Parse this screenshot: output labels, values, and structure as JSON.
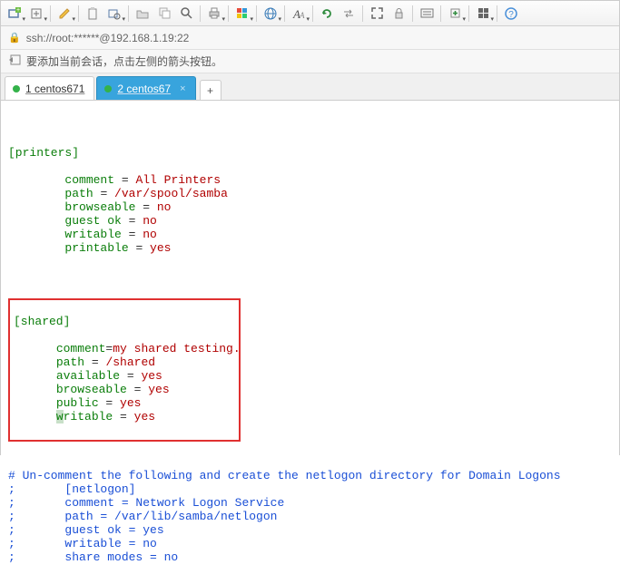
{
  "address": "ssh://root:******@192.168.1.19:22",
  "hint": "要添加当前会话，点击左侧的箭头按钮。",
  "tabs": [
    {
      "label": "1 centos671",
      "dot": "#34b24a",
      "active": false
    },
    {
      "label": "2 centos67",
      "dot": "#34b24a",
      "active": true
    }
  ],
  "code": {
    "printers": {
      "section": "[printers]",
      "lines": [
        {
          "key": "comment",
          "val": "All Printers",
          "eq": " = "
        },
        {
          "key": "path",
          "val": "/var/spool/samba",
          "eq": " = "
        },
        {
          "key": "browseable",
          "val": "no",
          "eq": " = "
        },
        {
          "key": "guest ok",
          "val": "no",
          "eq": " = "
        },
        {
          "key": "writable",
          "val": "no",
          "eq": " = "
        },
        {
          "key": "printable",
          "val": "yes",
          "eq": " = "
        }
      ]
    },
    "shared": {
      "section": "[shared]",
      "lines": [
        {
          "key": "comment",
          "val": "my shared testing.",
          "eq": "="
        },
        {
          "key": "path",
          "val": "/shared",
          "eq": " = "
        },
        {
          "key": "available",
          "val": "yes",
          "eq": " = "
        },
        {
          "key": "browseable",
          "val": "yes",
          "eq": " = "
        },
        {
          "key": "public",
          "val": "yes",
          "eq": " = "
        },
        {
          "key": "writable",
          "val": "yes",
          "eq": " = ",
          "cursor": true
        }
      ]
    },
    "comments": [
      "# Un-comment the following and create the netlogon directory for Domain Logons",
      ";       [netlogon]",
      ";       comment = Network Logon Service",
      ";       path = /var/lib/samba/netlogon",
      ";       guest ok = yes",
      ";       writable = no",
      ";       share modes = no"
    ]
  },
  "toolbar_icons": [
    "new-session-icon",
    "add-icon",
    "sep",
    "pencil-icon",
    "sep",
    "clipboard-icon",
    "settings-icon",
    "sep",
    "folder-icon",
    "copy-icon",
    "search-icon",
    "sep",
    "printer-icon",
    "sep",
    "color-icon",
    "sep",
    "globe-icon",
    "sep",
    "font-icon",
    "sep",
    "refresh-icon",
    "swap-icon",
    "sep",
    "expand-icon",
    "lock-icon",
    "sep",
    "keyboard-icon",
    "sep",
    "insert-icon",
    "sep",
    "grid-icon",
    "sep",
    "help-icon"
  ]
}
